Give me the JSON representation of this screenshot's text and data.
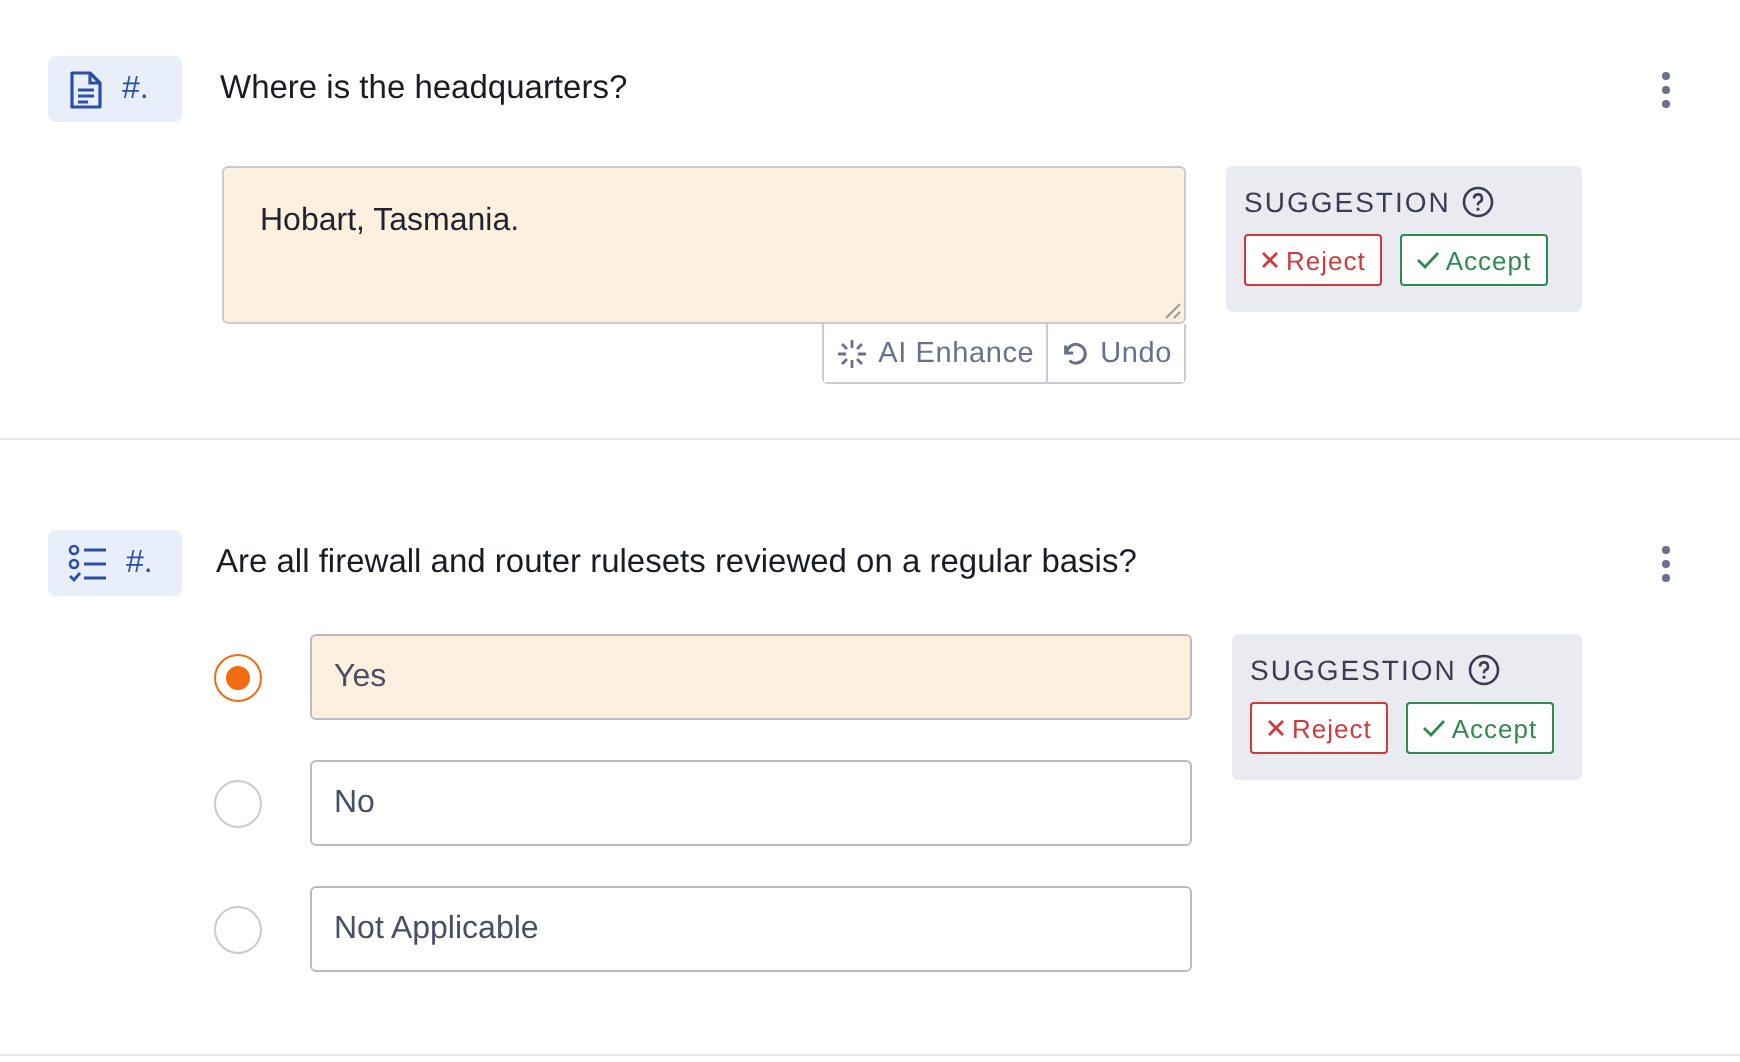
{
  "questions": [
    {
      "kind": "text",
      "number": "#.",
      "question": "Where is the headquarters?",
      "answer": "Hobart, Tasmania.",
      "answer_highlighted": true,
      "tools": [
        "AI Enhance",
        "Undo"
      ],
      "suggestion": {
        "label": "SUGGESTION",
        "reject": "Reject",
        "accept": "Accept"
      }
    },
    {
      "kind": "choice",
      "number": "#.",
      "question": "Are all firewall and router rulesets reviewed on a regular basis?",
      "options": [
        {
          "label": "Yes",
          "selected": true
        },
        {
          "label": "No",
          "selected": false
        },
        {
          "label": "Not Applicable",
          "selected": false
        }
      ],
      "suggestion": {
        "label": "SUGGESTION",
        "reject": "Reject",
        "accept": "Accept"
      }
    }
  ]
}
